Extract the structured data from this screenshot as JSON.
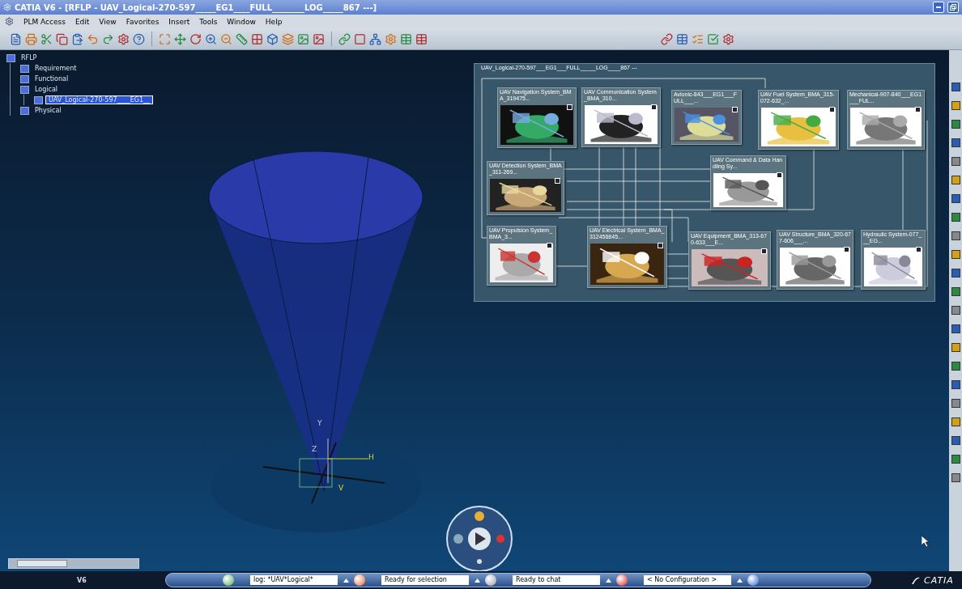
{
  "window": {
    "title": "CATIA V6 - [RFLP - UAV_Logical-270-597_____EG1____FULL________LOG_____867 ---]"
  },
  "menu": [
    "PLM Access",
    "Edit",
    "View",
    "Favorites",
    "Insert",
    "Tools",
    "Window",
    "Help"
  ],
  "tree": {
    "label": "RFLP",
    "selected": false,
    "children": [
      {
        "label": "Requirement",
        "selected": false
      },
      {
        "label": "Functional",
        "selected": false
      },
      {
        "label": "Logical",
        "selected": false,
        "children": [
          {
            "label": "UAV_Logical-270-597____EG1__",
            "selected": true
          }
        ]
      },
      {
        "label": "Physical",
        "selected": false
      }
    ]
  },
  "compass": {
    "labels": [
      "H",
      "V",
      "Y",
      "Z"
    ]
  },
  "diagram": {
    "title": "UAV_Logical-270-597___EG1___FULL_____LOG____867 ---",
    "blocks": [
      {
        "title": "UAV Navigation System_BMA_319475..."
      },
      {
        "title": "UAV Communication System_BMA_310..."
      },
      {
        "title": "Avionic-843___EG1___FULL___..."
      },
      {
        "title": "UAV Fuel System_BMA_315-072-632_..."
      },
      {
        "title": "Mechanical-907-840___EG1___FUL..."
      },
      {
        "title": "UAV Detection System_BMA_311-269..."
      },
      {
        "title": "UAV Command & Data Handling Sy..."
      },
      {
        "title": "UAV Propulsion System_BMA_3..."
      },
      {
        "title": "UAV Electrical System_BMA_312456845..."
      },
      {
        "title": "UAV Equipment_BMA_313-670-633___E..."
      },
      {
        "title": "UAV Structure_BMA_320-677-606___..."
      },
      {
        "title": "Hydraulic System-077___EG..."
      }
    ]
  },
  "status_bar": {
    "product": "V6",
    "fields": [
      "log: *UAV*Logical*",
      "Ready for selection",
      "Ready to chat",
      "< No Configuration >"
    ],
    "brand": "CATIA"
  }
}
